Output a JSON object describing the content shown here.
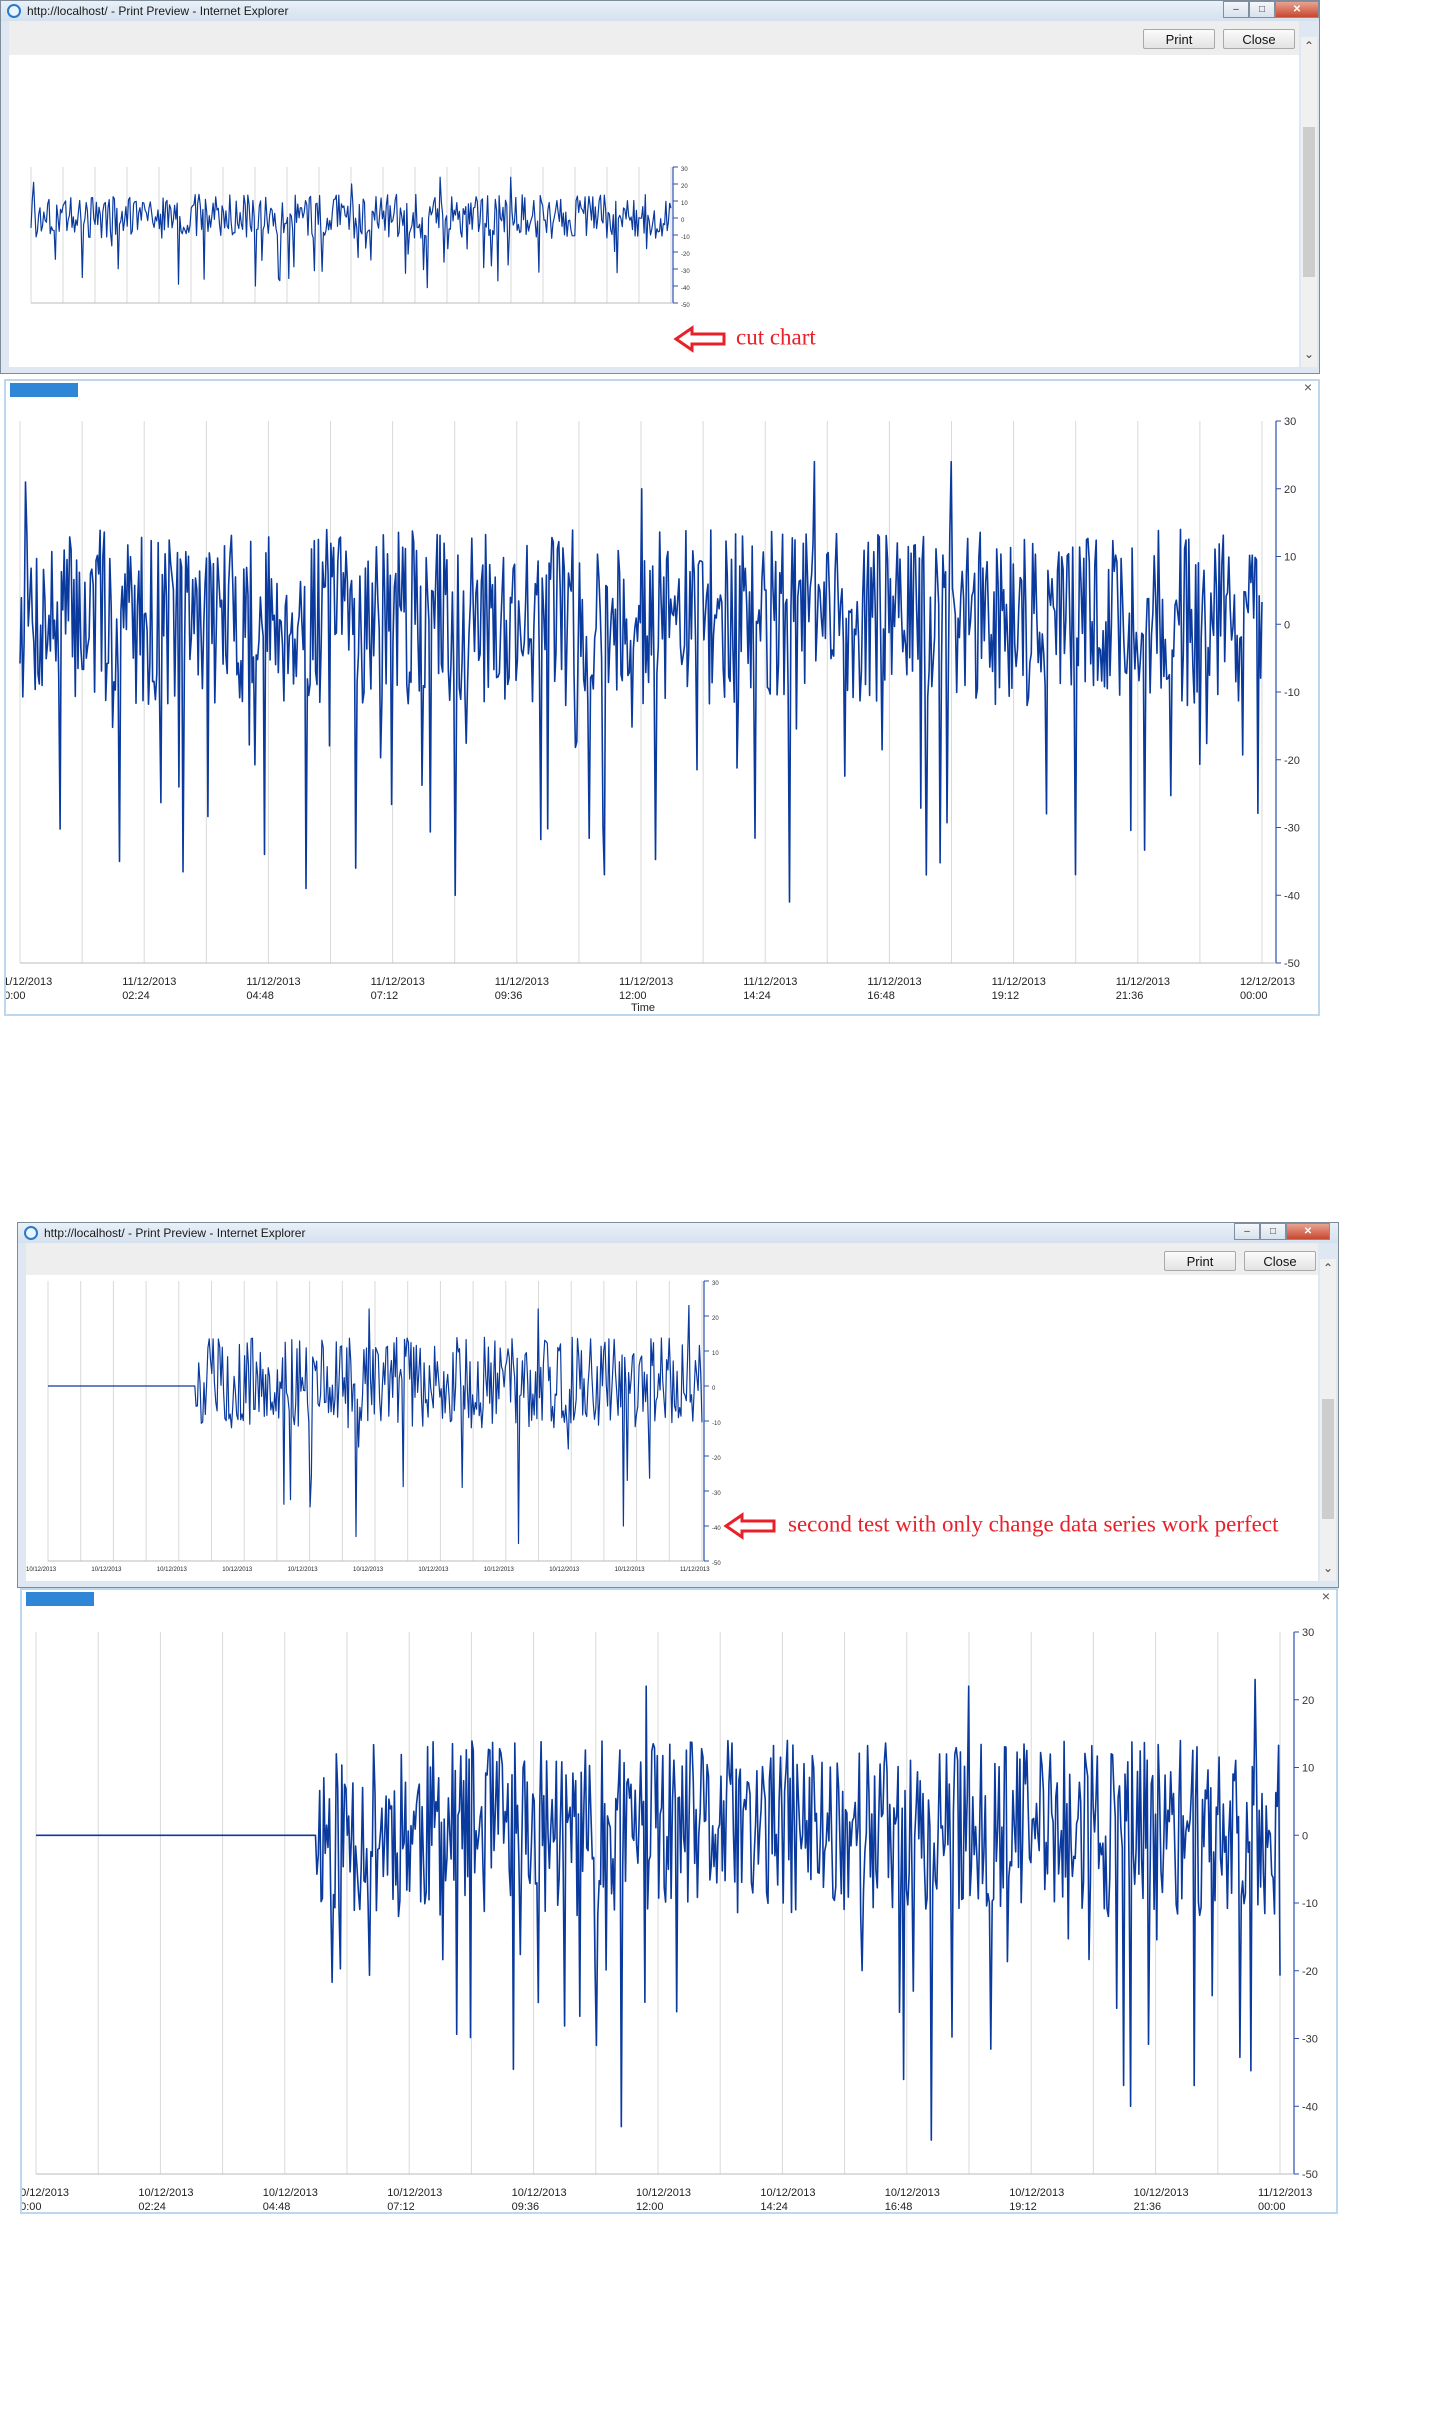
{
  "window1": {
    "title": "http://localhost/ - Print Preview - Internet Explorer",
    "print_label": "Print",
    "close_label": "Close",
    "annotation": "cut chart"
  },
  "window2": {
    "title": "http://localhost/ - Print Preview - Internet Explorer",
    "print_label": "Print",
    "close_label": "Close",
    "annotation": "second test with only change data series work perfect"
  },
  "panel1": {
    "close_glyph": "×",
    "x_title": "Time",
    "x_labels": [
      [
        "11/12/2013",
        "00:00"
      ],
      [
        "11/12/2013",
        "02:24"
      ],
      [
        "11/12/2013",
        "04:48"
      ],
      [
        "11/12/2013",
        "07:12"
      ],
      [
        "11/12/2013",
        "09:36"
      ],
      [
        "11/12/2013",
        "12:00"
      ],
      [
        "11/12/2013",
        "14:24"
      ],
      [
        "11/12/2013",
        "16:48"
      ],
      [
        "11/12/2013",
        "19:12"
      ],
      [
        "11/12/2013",
        "21:36"
      ],
      [
        "12/12/2013",
        "00:00"
      ]
    ]
  },
  "panel2": {
    "close_glyph": "×",
    "x_labels": [
      [
        "10/12/2013",
        "00:00"
      ],
      [
        "10/12/2013",
        "02:24"
      ],
      [
        "10/12/2013",
        "04:48"
      ],
      [
        "10/12/2013",
        "07:12"
      ],
      [
        "10/12/2013",
        "09:36"
      ],
      [
        "10/12/2013",
        "12:00"
      ],
      [
        "10/12/2013",
        "14:24"
      ],
      [
        "10/12/2013",
        "16:48"
      ],
      [
        "10/12/2013",
        "19:12"
      ],
      [
        "10/12/2013",
        "21:36"
      ],
      [
        "11/12/2013",
        "00:00"
      ]
    ]
  },
  "colors": {
    "series": "#0a3a9e",
    "axis": "#2a4fb0",
    "grid": "#d9d9d9",
    "annotation": "#e8202a"
  },
  "chart_data": [
    {
      "type": "line",
      "series": [
        {
          "values_description_only": null
        }
      ],
      "x": [
        "11/12/2013 00:00",
        "11/12/2013 02:24",
        "11/12/2013 04:48",
        "11/12/2013 07:12",
        "11/12/2013 09:36",
        "11/12/2013 12:00",
        "11/12/2013 14:24",
        "11/12/2013 16:48",
        "11/12/2013 19:12",
        "11/12/2013 21:36",
        "12/12/2013 00:00"
      ],
      "y_ticks": [
        30,
        20,
        10,
        0,
        -10,
        -20,
        -30,
        -40,
        -50
      ],
      "ylim": [
        -50,
        30
      ],
      "xlabel": "Time",
      "grid": "vertical",
      "y_axis": "right",
      "oscillation_range": [
        -12,
        14
      ],
      "spikes": [
        [
          0.005,
          -44
        ],
        [
          0.005,
          21
        ],
        [
          0.08,
          -35
        ],
        [
          0.23,
          -39
        ],
        [
          0.27,
          -36
        ],
        [
          0.35,
          -40
        ],
        [
          0.5,
          20
        ],
        [
          0.62,
          -41
        ],
        [
          0.64,
          24
        ],
        [
          0.73,
          -37
        ],
        [
          0.75,
          24
        ]
      ]
    },
    {
      "type": "line",
      "x": [
        "10/12/2013 00:00",
        "10/12/2013 02:24",
        "10/12/2013 04:48",
        "10/12/2013 07:12",
        "10/12/2013 09:36",
        "10/12/2013 12:00",
        "10/12/2013 14:24",
        "10/12/2013 16:48",
        "10/12/2013 19:12",
        "10/12/2013 21:36",
        "11/12/2013 00:00"
      ],
      "y_ticks": [
        30,
        20,
        10,
        0,
        -10,
        -20,
        -30,
        -40,
        -50
      ],
      "ylim": [
        -50,
        30
      ],
      "grid": "vertical",
      "y_axis": "right",
      "flat_until": 0.225,
      "flat_value": 0,
      "oscillation_range": [
        -12,
        14
      ],
      "spikes": [
        [
          0.47,
          -43
        ],
        [
          0.49,
          22
        ],
        [
          0.72,
          -45
        ],
        [
          0.75,
          22
        ],
        [
          0.88,
          -40
        ],
        [
          0.98,
          23
        ]
      ]
    }
  ]
}
